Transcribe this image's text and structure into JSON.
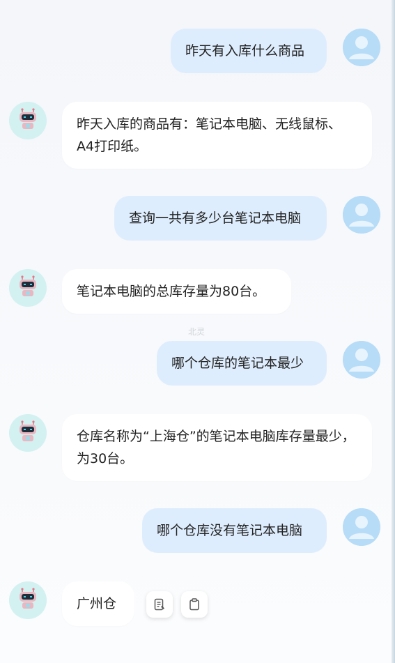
{
  "messages": [
    {
      "role": "user",
      "text": "昨天有入库什么商品"
    },
    {
      "role": "assistant",
      "text": "昨天入库的商品有：笔记本电脑、无线鼠标、A4打印纸。"
    },
    {
      "role": "user",
      "text": "查询一共有多少台笔记本电脑"
    },
    {
      "role": "assistant",
      "text": "笔记本电脑的总库存量为80台。"
    },
    {
      "role": "user",
      "text": "哪个仓库的笔记本最少"
    },
    {
      "role": "assistant",
      "text": "仓库名称为“上海仓”的笔记本电脑库存量最少，为30台。"
    },
    {
      "role": "user",
      "text": "哪个仓库没有笔记本电脑"
    },
    {
      "role": "assistant",
      "text": "广州仓"
    }
  ],
  "watermark": "北灵",
  "icons": {
    "user_avatar": "user-avatar-icon",
    "bot_avatar": "robot-avatar-icon",
    "actions": [
      "document-icon",
      "clipboard-icon"
    ]
  },
  "colors": {
    "user_bubble": "#deedfd",
    "bot_bubble": "#ffffff",
    "user_avatar": "#b7dcf7",
    "bot_avatar": "#d4f1f2"
  }
}
